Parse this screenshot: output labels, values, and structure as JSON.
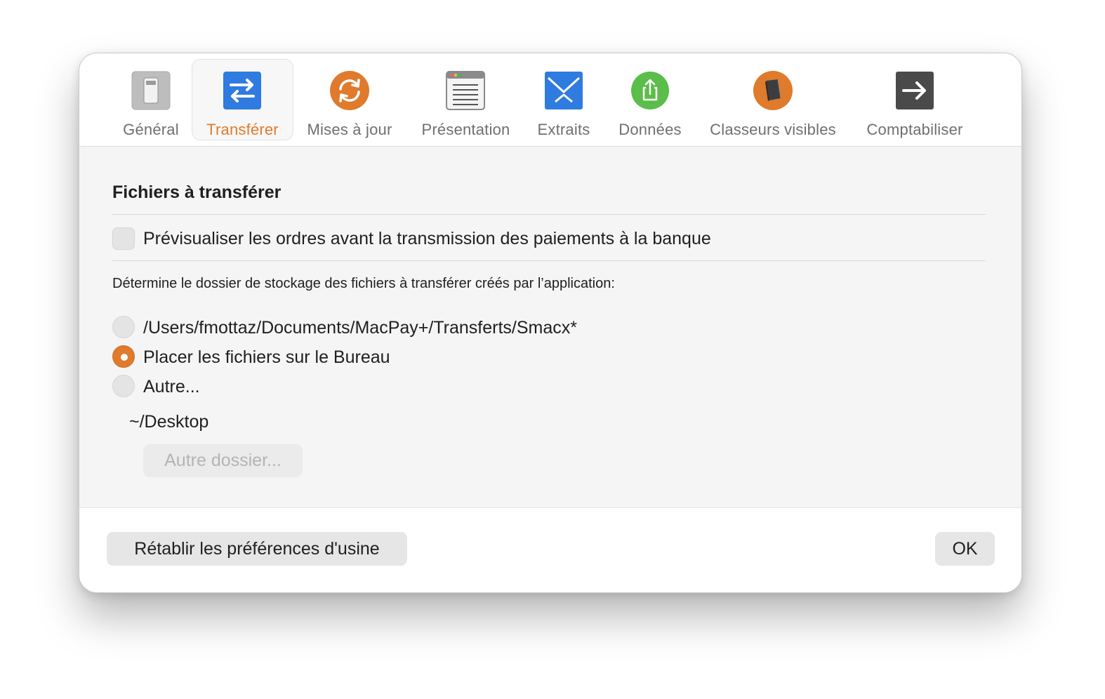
{
  "toolbar": {
    "tabs": [
      {
        "label": "Général",
        "icon": "switch-icon",
        "active": false
      },
      {
        "label": "Transférer",
        "icon": "transfer-arrows-icon",
        "active": true
      },
      {
        "label": "Mises à jour",
        "icon": "refresh-icon",
        "active": false
      },
      {
        "label": "Présentation",
        "icon": "list-window-icon",
        "active": false
      },
      {
        "label": "Extraits",
        "icon": "envelope-icon",
        "active": false
      },
      {
        "label": "Données",
        "icon": "share-icon",
        "active": false
      },
      {
        "label": "Classeurs visibles",
        "icon": "book-icon",
        "active": false
      },
      {
        "label": "Comptabiliser",
        "icon": "arrow-right-icon",
        "active": false
      }
    ]
  },
  "content": {
    "section_title": "Fichiers à transférer",
    "preview_checkbox": {
      "label": "Prévisualiser les ordres avant la transmission des paiements à la banque",
      "checked": false
    },
    "description": "Détermine le dossier de stockage des fichiers à transférer créés par l’application:",
    "radio_options": [
      {
        "label": "/Users/fmottaz/Documents/MacPay+/Transferts/Smacx*",
        "selected": false
      },
      {
        "label": "Placer les fichiers sur le Bureau",
        "selected": true
      },
      {
        "label": "Autre...",
        "selected": false
      }
    ],
    "current_path": "~/Desktop",
    "other_folder_button": "Autre dossier..."
  },
  "footer": {
    "reset_button": "Rétablir les préférences d'usine",
    "ok_button": "OK"
  },
  "colors": {
    "accent": "#e07a2c",
    "blue_icon": "#2f7be0",
    "green_icon": "#5bbd4a",
    "dark_icon": "#4a4a4a"
  }
}
